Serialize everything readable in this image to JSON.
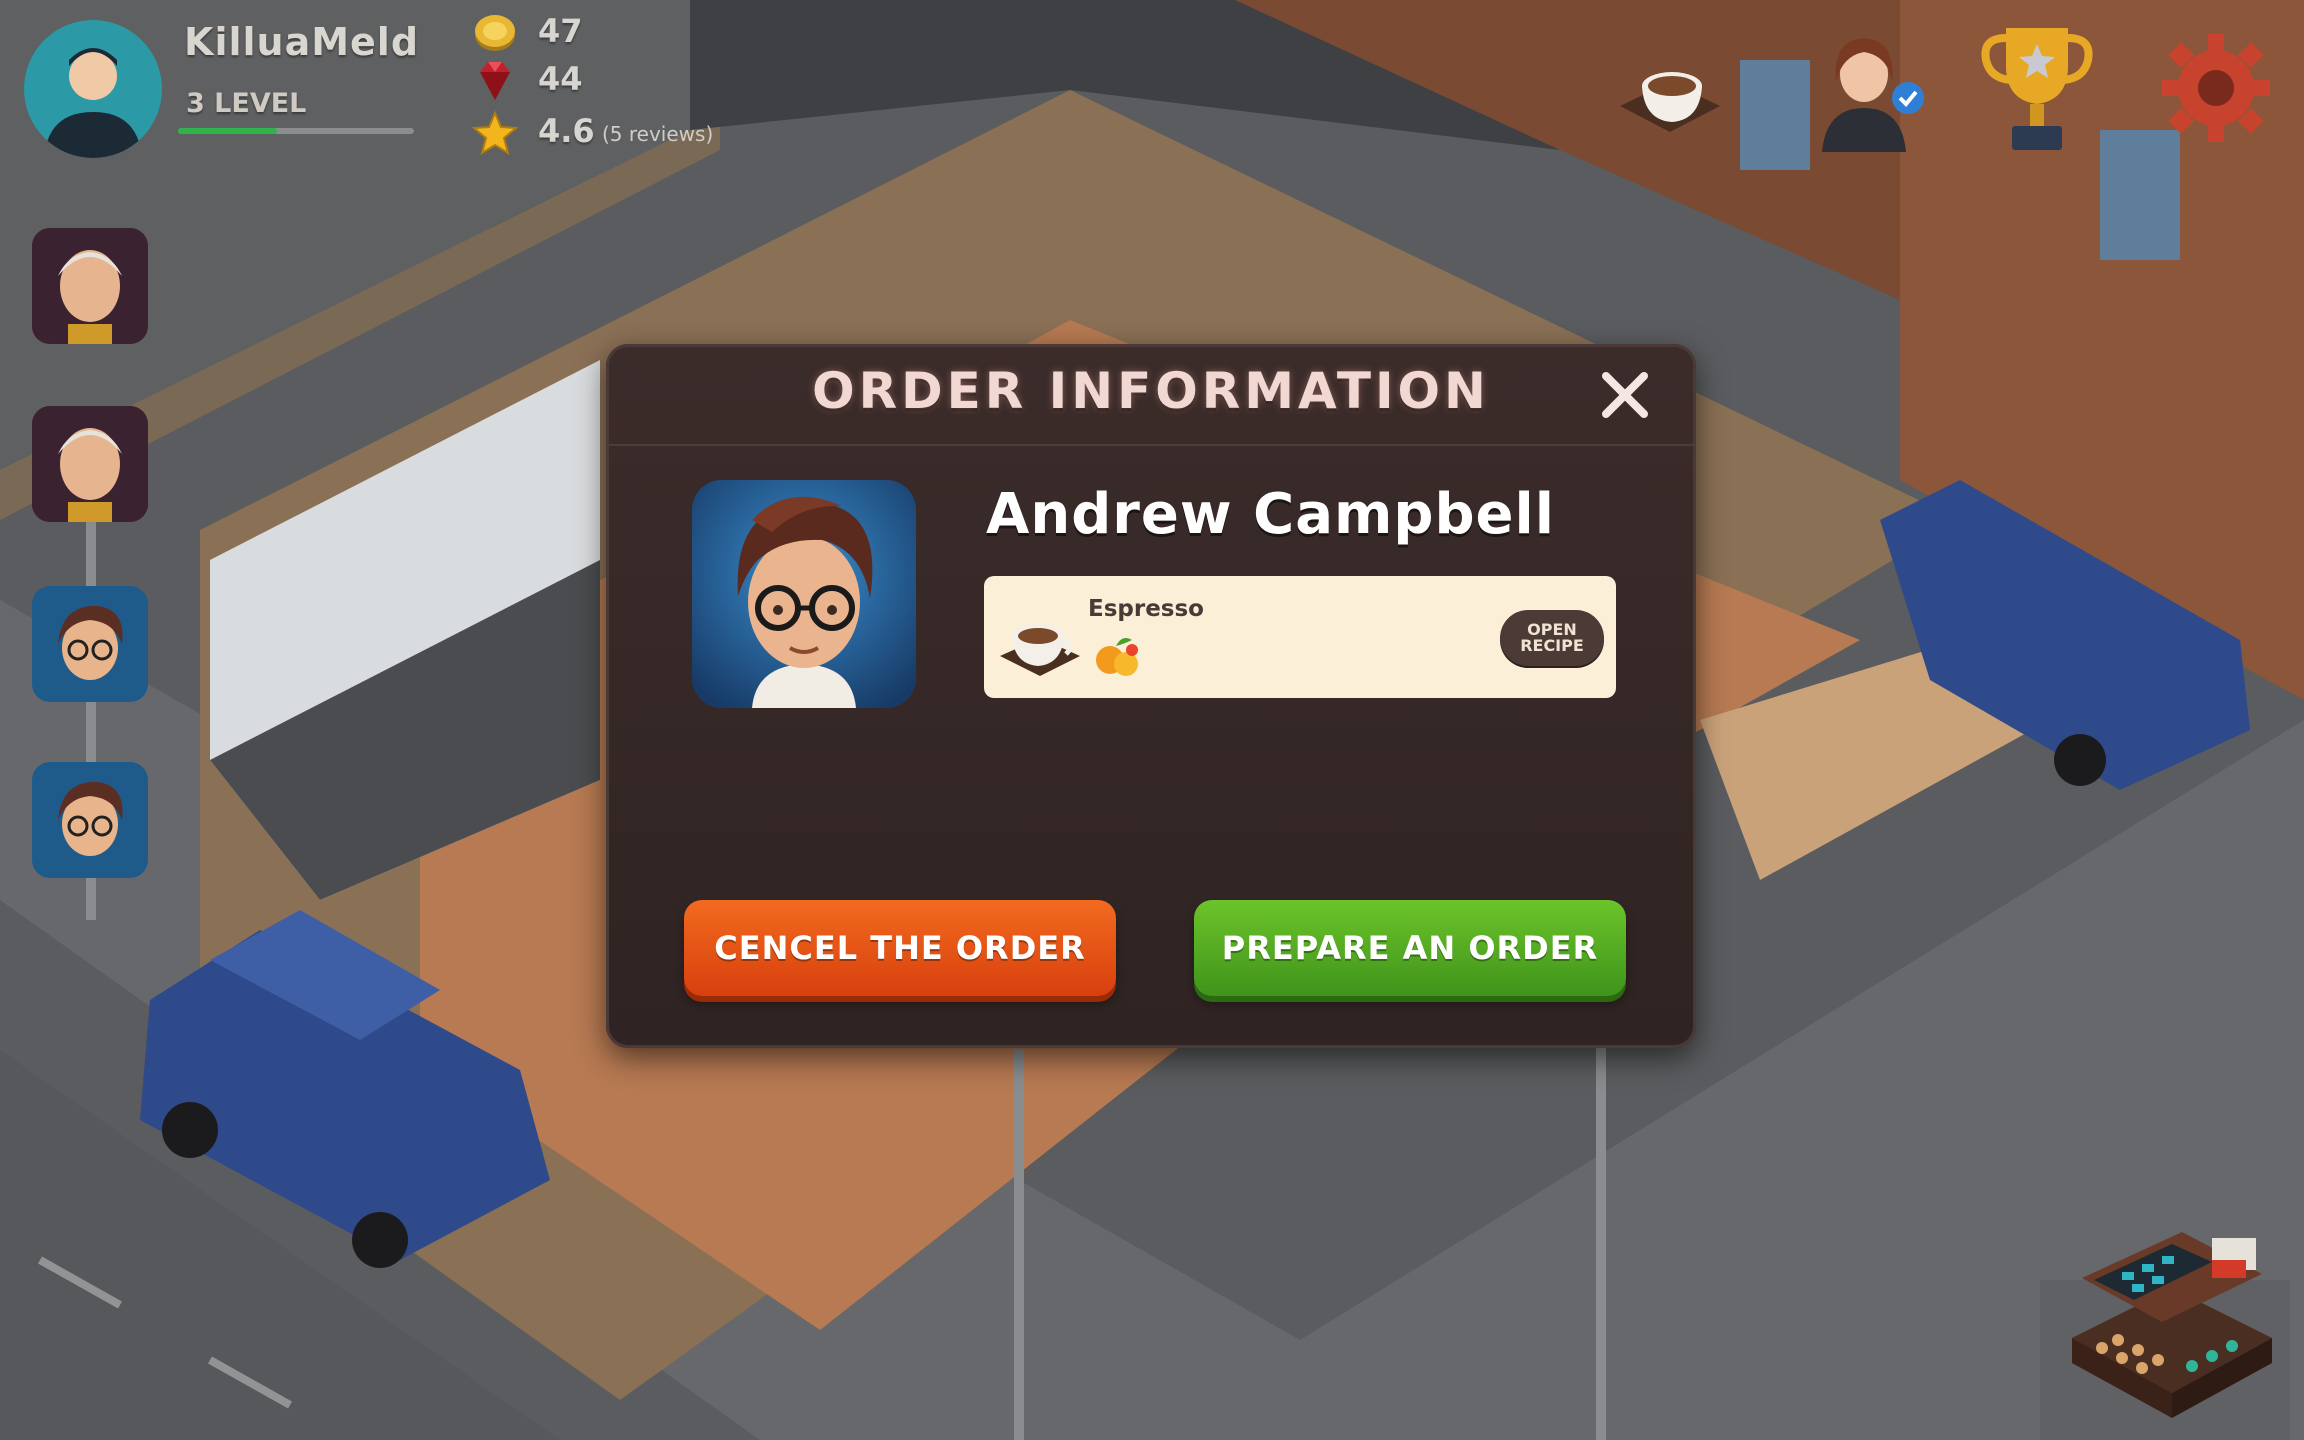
{
  "player": {
    "name": "KilluaMeld",
    "level_label": "3 LEVEL",
    "xp_progress": 0.42
  },
  "stats": {
    "coins": "47",
    "gems": "44",
    "rating": "4.6",
    "reviews": "(5 reviews)"
  },
  "queue": {
    "customers": [
      "elderly-man-portrait",
      "elderly-man-portrait",
      "young-man-glasses-portrait",
      "young-man-glasses-portrait"
    ]
  },
  "top_right": {
    "icons": [
      "coffee-cup-icon",
      "manager-icon",
      "trophy-icon",
      "settings-gear-icon"
    ]
  },
  "modal": {
    "title": "ORDER INFORMATION",
    "customer_name": "Andrew Campbell",
    "order": {
      "item_name": "Espresso",
      "item_icon": "espresso-cup-icon",
      "ingredient_icon": "fruit-icon",
      "recipe_button": "OPEN\nRECIPE"
    },
    "cancel_label": "CENCEL THE ORDER",
    "prepare_label": "PREPARE AN ORDER"
  },
  "colors": {
    "modal_bg": "#33272a",
    "cancel": "#e4521a",
    "prepare": "#54ab22",
    "order_card": "#fbefd8",
    "title": "#f2d8d3"
  }
}
